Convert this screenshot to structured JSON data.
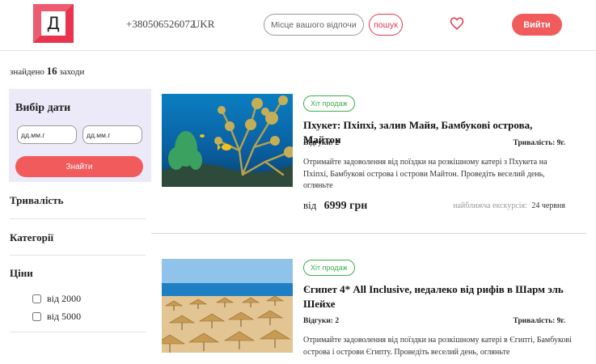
{
  "header": {
    "logo_letter": "Д",
    "phone": "+380506526072",
    "country": "UKR",
    "search_placeholder": "Місце вашого відпочинку.",
    "search_button": "пошук",
    "login_button": "Вийти"
  },
  "results": {
    "prefix": "знайдено",
    "count": "16",
    "suffix": "заходи"
  },
  "sidebar": {
    "date_title": "Вибір дати",
    "date_from_placeholder": "дд.мм.г",
    "date_to_placeholder": "дд.мм.г",
    "find_button": "Знайти",
    "sections": {
      "duration": "Тривалість",
      "categories": "Категорії",
      "prices": "Ціни"
    },
    "price_options": [
      "від 2000",
      "від 5000"
    ]
  },
  "tours": [
    {
      "badge": "Хіт продаж",
      "title": "Пхукет: Пхіпхі, залив Майя, Бамбукові острова, Майтон",
      "reviews": "Відгуки: 2",
      "duration": "Тривалість: 9г.",
      "description": "Отримайте задоволення від поїздки на розкішному катері з Пхукета на Пхіпхі, Бамбукові острова і острови Майтон. Проведіть веселий день, огляньте",
      "price_prefix": "від",
      "price": "6999 грн",
      "nearest_label": "найближча екскурсія:",
      "nearest_date": "24 червня"
    },
    {
      "badge": "Хіт продаж",
      "title": "Єгипет 4* All Inclusive, недалеко від рифів в Шарм эль Шейхе",
      "reviews": "Відгуки: 2",
      "duration": "Тривалість: 9г.",
      "description": "Отримайте задоволення від поїздки на розкішному катері в Єгипті, Бамбукові острова і острови Єгипту. Проведіть веселий день, огляньте"
    }
  ],
  "colors": {
    "accent": "#f25b5b",
    "brand": "#e8344e",
    "badge": "#3bb04a",
    "panel": "#eceaf8"
  }
}
